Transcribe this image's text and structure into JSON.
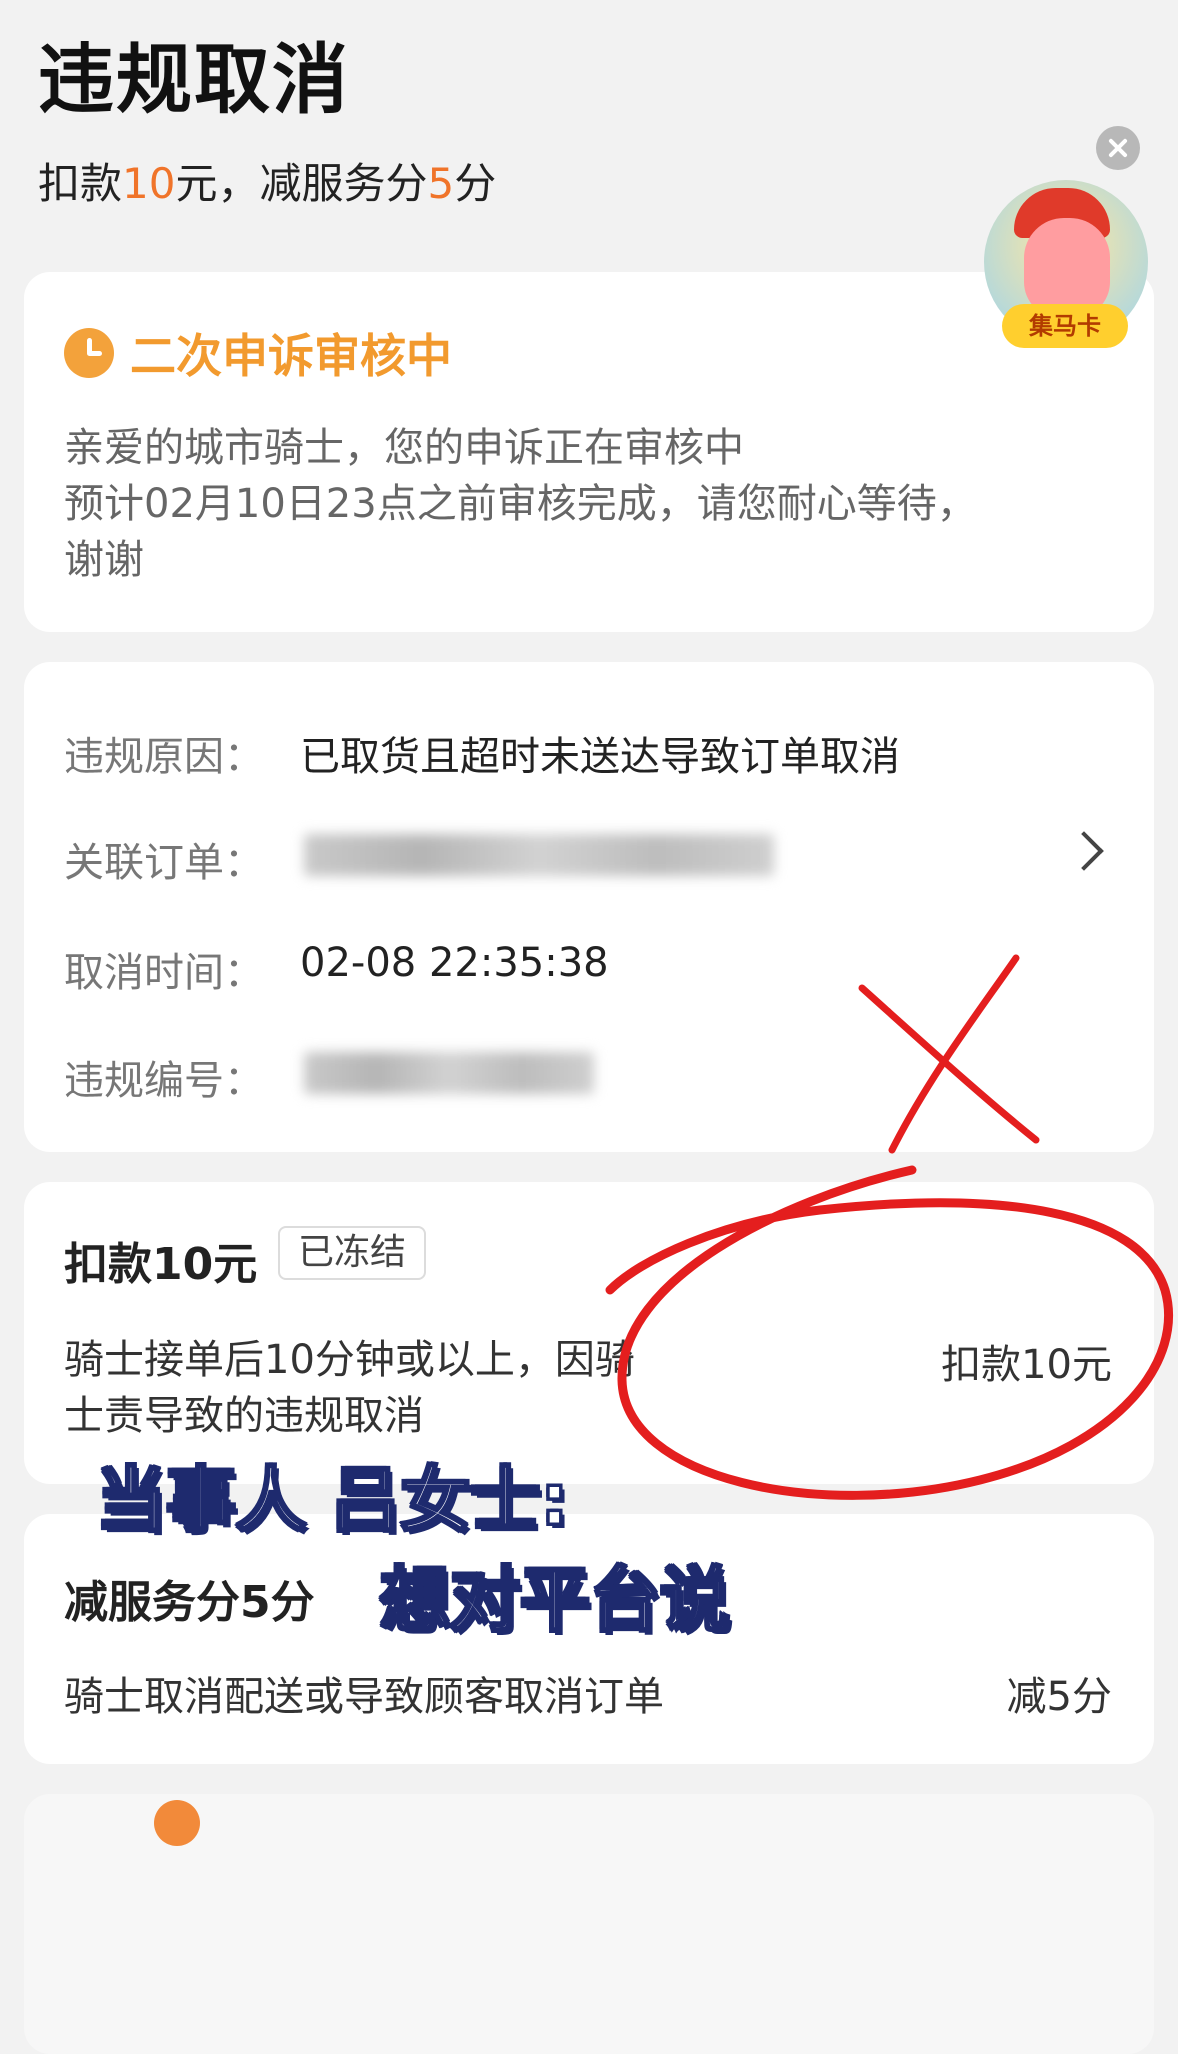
{
  "page": {
    "title": "违规取消",
    "subtitle_prefix": "扣款",
    "subtitle_amount": "10",
    "subtitle_mid": "元，减服务分",
    "subtitle_score": "5",
    "subtitle_suffix": "分"
  },
  "status_card": {
    "icon": "clock-icon",
    "title": "二次申诉审核中",
    "message_lines": [
      "亲爱的城市骑士，您的申诉正在审核中",
      "预计02月10日23点之前审核完成，请您耐心等待，",
      "谢谢"
    ]
  },
  "info_card": {
    "reason_label": "违规原因：",
    "reason_value": "已取货且超时未送达导致订单取消",
    "order_label": "关联订单：",
    "cancel_time_label": "取消时间：",
    "cancel_time_value": "02-08 22:35:38",
    "violation_no_label": "违规编号："
  },
  "deduct_card": {
    "title": "扣款10元",
    "tag": "已冻结",
    "description": "骑士接单后10分钟或以上，因骑士责导致的违规取消",
    "amount": "扣款10元"
  },
  "score_card": {
    "title": "减服务分5分",
    "description": "骑士取消配送或导致顾客取消订单",
    "amount": "减5分"
  },
  "overlay": {
    "caption_line1": "当事人 吕女士:",
    "caption_line2": "想对平台说"
  },
  "floating": {
    "badge_label": "集马卡"
  },
  "colors": {
    "accent_orange": "#f0742a",
    "status_orange": "#f29a2e",
    "annotation_red": "#e41e1e",
    "caption_outline": "#1e2a6e"
  }
}
